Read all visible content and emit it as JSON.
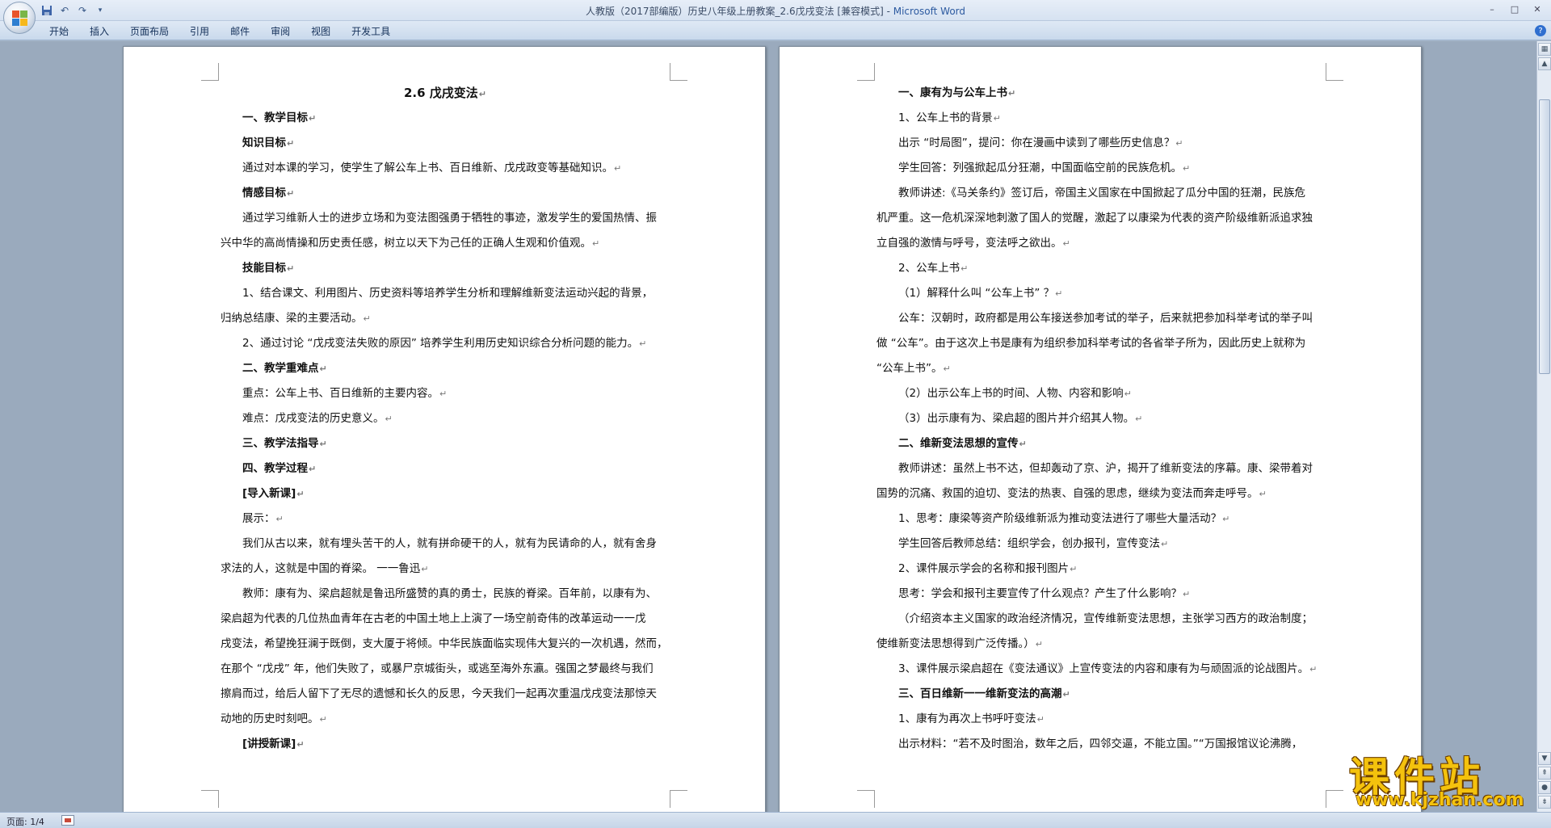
{
  "window": {
    "title_prefix": "人教版（2017部编版）历史八年级上册教案_2.6戊戌变法 [兼容模式] - ",
    "title_app": "Microsoft Word",
    "minimize": "–",
    "maximize": "□",
    "close": "✕"
  },
  "qat": [
    "save-icon",
    "undo-icon",
    "redo-icon",
    "customize-icon"
  ],
  "ribbon": {
    "tabs": [
      "开始",
      "插入",
      "页面布局",
      "引用",
      "邮件",
      "审阅",
      "视图",
      "开发工具"
    ],
    "help": "?"
  },
  "page1": {
    "title": "2.6  戊戌变法",
    "lines": [
      "一、教学目标",
      "知识目标",
      "通过对本课的学习，使学生了解公车上书、百日维新、戊戌政变等基础知识。",
      "情感目标",
      "通过学习维新人士的进步立场和为变法图强勇于牺牲的事迹，激发学生的爱国热情、振",
      "兴中华的高尚情操和历史责任感，树立以天下为己任的正确人生观和价值观。",
      "技能目标",
      "1、结合课文、利用图片、历史资料等培养学生分析和理解维新变法运动兴起的背景，",
      "归纳总结康、梁的主要活动。",
      "2、通过讨论  “戊戌变法失败的原因” 培养学生利用历史知识综合分析问题的能力。",
      "二、教学重难点",
      "重点：公车上书、百日维新的主要内容。",
      "难点：戊戌变法的历史意义。",
      "三、教学法指导",
      "四、教学过程",
      "[导入新课]",
      "展示：",
      "我们从古以来，就有埋头苦干的人，就有拼命硬干的人，就有为民请命的人，就有舍身",
      "求法的人，这就是中国的脊梁。                    一一鲁迅",
      "教师：康有为、梁启超就是鲁迅所盛赞的真的勇士，民族的脊梁。百年前，以康有为、",
      "梁启超为代表的几位热血青年在古老的中国土地上上演了一场空前奇伟的改革运动一一戊",
      "戌变法，希望挽狂澜于既倒，支大厦于将倾。中华民族面临实现伟大复兴的一次机遇，然而，",
      "在那个 “戊戌” 年，他们失败了，或暴尸京城街头，或逃至海外东瀛。强国之梦最终与我们",
      "擦肩而过，给后人留下了无尽的遗憾和长久的反思，今天我们一起再次重温戊戌变法那惊天",
      "动地的历史时刻吧。",
      "[讲授新课]"
    ]
  },
  "page2": {
    "lines": [
      "一、康有为与公车上书",
      "1、公车上书的背景",
      "出示 “时局图”，提问：你在漫画中读到了哪些历史信息？",
      "学生回答：列强掀起瓜分狂潮，中国面临空前的民族危机。",
      "教师讲述:《马关条约》签订后，帝国主义国家在中国掀起了瓜分中国的狂潮，民族危",
      "机严重。这一危机深深地刺激了国人的觉醒，激起了以康梁为代表的资产阶级维新派追求独",
      "立自强的激情与呼号，变法呼之欲出。",
      "2、公车上书",
      "（1）解释什么叫 “公车上书” ？",
      "公车：汉朝时，政府都是用公车接送参加考试的举子，后来就把参加科举考试的举子叫",
      "做 “公车”。由于这次上书是康有为组织参加科举考试的各省举子所为，因此历史上就称为",
      "“公车上书”。",
      "（2）出示公车上书的时间、人物、内容和影响",
      "（3）出示康有为、梁启超的图片并介绍其人物。",
      "二、维新变法思想的宣传",
      "教师讲述：虽然上书不达，但却轰动了京、沪，揭开了维新变法的序幕。康、梁带着对",
      "国势的沉痛、救国的迫切、变法的热衷、自强的思虑，继续为变法而奔走呼号。",
      "1、思考：康梁等资产阶级维新派为推动变法进行了哪些大量活动？",
      "学生回答后教师总结：组织学会，创办报刊，宣传变法",
      "2、课件展示学会的名称和报刊图片",
      "思考：学会和报刊主要宣传了什么观点？产生了什么影响？",
      "（介绍资本主义国家的政治经济情况，宣传维新变法思想，主张学习西方的政治制度；",
      "使维新变法思想得到广泛传播。）",
      "3、课件展示梁启超在《变法通议》上宣传变法的内容和康有为与顽固派的论战图片。",
      "三、百日维新一一维新变法的高潮",
      "1、康有为再次上书呼吁变法",
      "出示材料：“若不及时图治，数年之后，四邻交逼，不能立国。”“万国报馆议论沸腾，"
    ]
  },
  "paragraph_mark": "↵",
  "statusbar": {
    "page": "页面: 1/4"
  },
  "watermark": {
    "main": "课件站",
    "url": "www.kjzhan.com"
  }
}
